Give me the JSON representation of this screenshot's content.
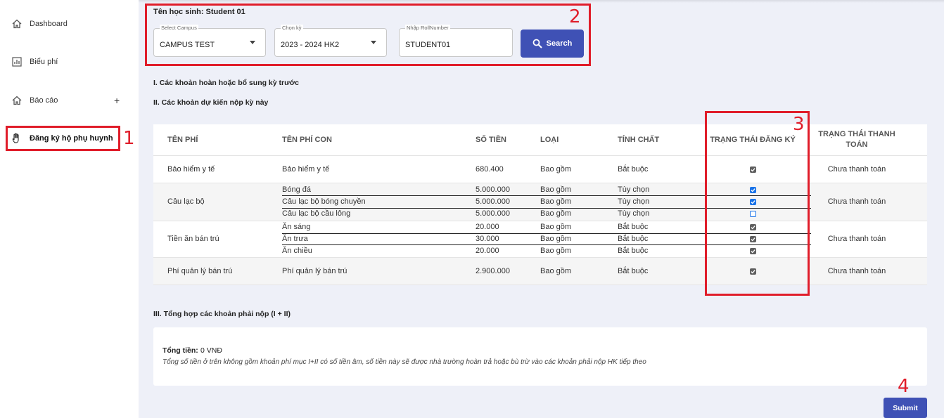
{
  "sidebar": {
    "items": [
      {
        "label": "Dashboard",
        "icon": "home-icon"
      },
      {
        "label": "Biểu phí",
        "icon": "bar-chart-icon"
      },
      {
        "label": "Báo cáo",
        "icon": "home-icon",
        "expand": "+"
      },
      {
        "label": "Đăng ký hộ phụ huynh",
        "icon": "hand-icon",
        "active": true
      }
    ]
  },
  "annotations": [
    "1",
    "2",
    "3",
    "4"
  ],
  "header": {
    "student_label": "Tên học sinh: Student 01"
  },
  "filters": {
    "campus": {
      "label": "Select Campus",
      "value": "CAMPUS TEST"
    },
    "term": {
      "label": "Chọn kỳ",
      "value": "2023 - 2024 HK2"
    },
    "roll": {
      "label": "Nhập RollNumber",
      "value": "STUDENT01"
    },
    "search_label": "Search"
  },
  "sections": {
    "s1": "I. Các khoản hoàn hoặc bổ sung kỳ trước",
    "s2": "II. Các khoản dự kiến nộp kỳ này",
    "s3": "III. Tổng hợp các khoản phải nộp (I + II)"
  },
  "table": {
    "headers": {
      "fee": "TÊN PHÍ",
      "subfee": "TÊN PHÍ CON",
      "amount": "SỐ TIỀN",
      "type": "LOẠI",
      "nature": "TÍNH CHẤT",
      "reg_status": "TRẠNG THÁI ĐĂNG KÝ",
      "pay_status": "TRẠNG THÁI THANH TOÁN"
    },
    "groups": [
      {
        "name": "Bảo hiểm y tế",
        "pay_status": "Chưa thanh toán",
        "rows": [
          {
            "sub": "Bảo hiểm y tế",
            "amount": "680.400",
            "type": "Bao gồm",
            "nature": "Bắt buộc",
            "check": "gray"
          }
        ]
      },
      {
        "name": "Câu lạc bộ",
        "pay_status": "Chưa thanh toán",
        "rows": [
          {
            "sub": "Bóng đá",
            "amount": "5.000.000",
            "type": "Bao gồm",
            "nature": "Tùy chọn",
            "check": "blue"
          },
          {
            "sub": "Câu lạc bộ bóng chuyền",
            "amount": "5.000.000",
            "type": "Bao gồm",
            "nature": "Tùy chọn",
            "check": "blue"
          },
          {
            "sub": "Câu lạc bộ cầu lông",
            "amount": "5.000.000",
            "type": "Bao gồm",
            "nature": "Tùy chọn",
            "check": "empty"
          }
        ]
      },
      {
        "name": "Tiền ăn bán trú",
        "pay_status": "Chưa thanh toán",
        "rows": [
          {
            "sub": "Ăn sáng",
            "amount": "20.000",
            "type": "Bao gồm",
            "nature": "Bắt buộc",
            "check": "gray"
          },
          {
            "sub": "Ăn trưa",
            "amount": "30.000",
            "type": "Bao gồm",
            "nature": "Bắt buộc",
            "check": "gray"
          },
          {
            "sub": "Ăn chiều",
            "amount": "20.000",
            "type": "Bao gồm",
            "nature": "Bắt buộc",
            "check": "gray"
          }
        ]
      },
      {
        "name": "Phí quản lý bán trú",
        "pay_status": "Chưa thanh toán",
        "rows": [
          {
            "sub": "Phí quản lý bán trú",
            "amount": "2.900.000",
            "type": "Bao gồm",
            "nature": "Bắt buộc",
            "check": "gray"
          }
        ]
      }
    ]
  },
  "summary": {
    "total_label": "Tổng tiền:",
    "total_value": "0 VNĐ",
    "note": "Tổng số tiền ở trên không gồm khoản phí mục I+II có số tiền âm, số tiền này sẽ được nhà trường hoàn trả hoặc bù trừ vào các khoản phải nộp HK tiếp theo"
  },
  "submit_label": "Submit",
  "colors": {
    "accent": "#3f51b5",
    "annotation": "#e01d2a"
  }
}
